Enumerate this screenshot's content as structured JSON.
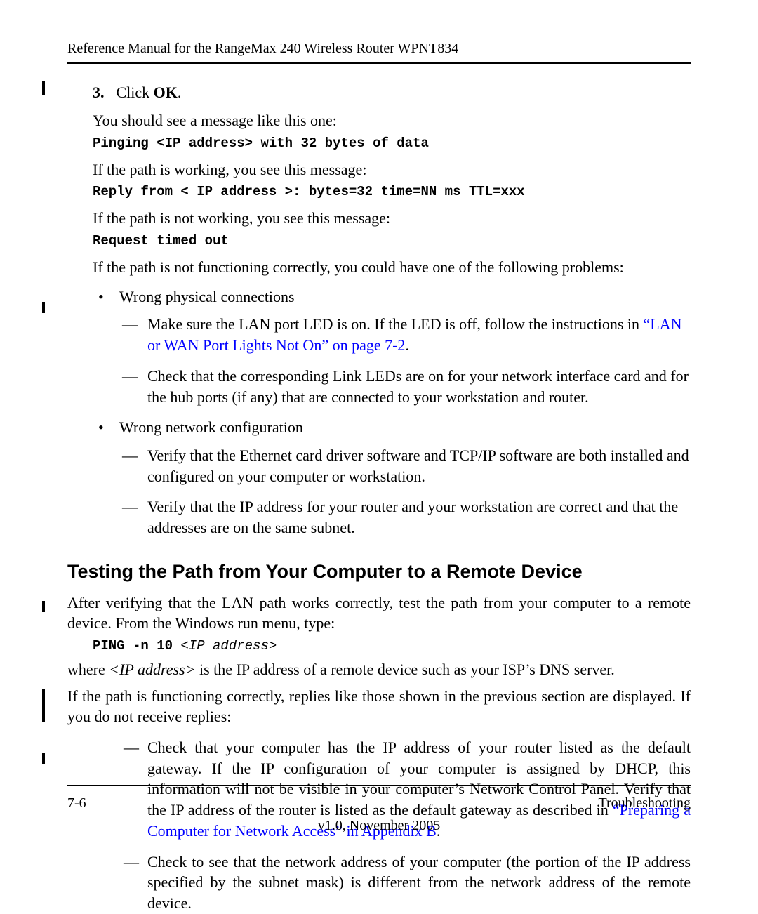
{
  "header": {
    "running_head": "Reference Manual for the RangeMax 240 Wireless Router WPNT834"
  },
  "step3": {
    "num": "3.",
    "text_prefix": "Click ",
    "bold": "OK",
    "text_suffix": "."
  },
  "lines": {
    "see_msg": "You should see a message like this one:",
    "ping_line": "Pinging <IP address> with 32 bytes of data",
    "working": "If the path is working, you see this message:",
    "reply_line": "Reply from < IP address >: bytes=32 time=NN ms TTL=xxx",
    "not_working": "If the path is not working, you see this message:",
    "timeout_line": "Request timed out",
    "not_func": "If the path is not functioning correctly, you could have one of the following problems:"
  },
  "bullets": {
    "wrong_phys": "Wrong physical connections",
    "phys_dash1_prefix": "Make sure the LAN port LED is on. If the LED is off, follow the instructions in ",
    "phys_dash1_link": "“LAN or WAN Port Lights Not On” on page 7-2",
    "phys_dash1_suffix": ".",
    "phys_dash2": "Check that the corresponding Link LEDs are on for your network interface card and for the hub ports (if any) that are connected to your workstation and router.",
    "wrong_net": "Wrong network configuration",
    "net_dash1": "Verify that the Ethernet card driver software and TCP/IP software are both installed and configured on your computer or workstation.",
    "net_dash2": "Verify that the IP address for your router and your workstation are correct and that the addresses are on the same subnet."
  },
  "section2": {
    "heading": "Testing the Path from Your Computer to a Remote Device",
    "p1": "After verifying that the LAN path works correctly, test the path from your computer to a remote device. From the Windows run menu, type:",
    "cmd_bold": "PING -n 10 ",
    "cmd_arg": "<IP address>",
    "p2_prefix": "where ",
    "p2_ital": "<IP address>",
    "p2_suffix": " is the IP address of a remote device such as your ISP’s DNS server.",
    "p3": "If the path is functioning correctly, replies like those shown in the previous section are displayed. If you do not receive replies:",
    "dash1_prefix": "Check that your computer has the IP address of your router listed as the default gateway. If the IP configuration of your computer is assigned by DHCP, this information will not be visible in your computer’s Network Control Panel. Verify that the IP address of the router is listed as the default gateway as described in ",
    "dash1_link": "“Preparing a Computer for Network Access” in Appendix B",
    "dash1_suffix": ".",
    "dash2": "Check to see that the network address of your computer (the portion of the IP address specified by the subnet mask) is different from the network address of the remote device."
  },
  "footer": {
    "left": "7-6",
    "right": "Troubleshooting",
    "center": "v1.0, November 2005"
  }
}
